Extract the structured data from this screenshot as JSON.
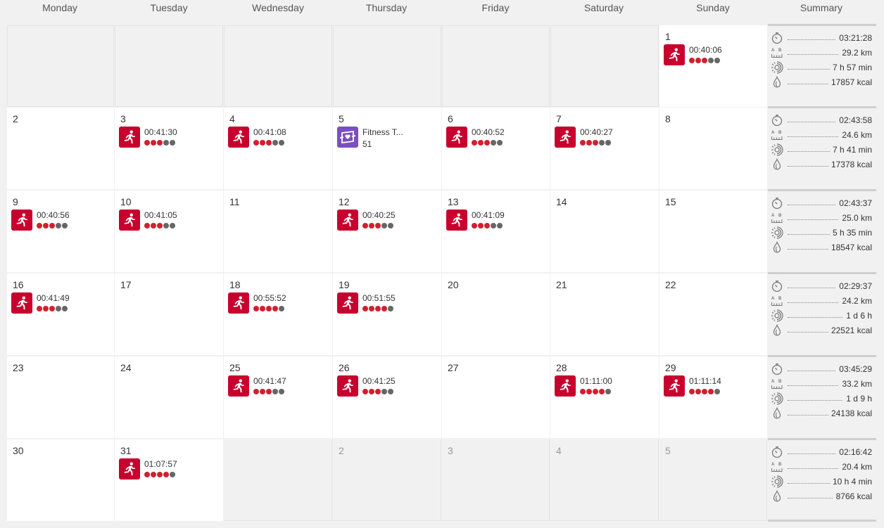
{
  "header": {
    "days": [
      "Monday",
      "Tuesday",
      "Wednesday",
      "Thursday",
      "Friday",
      "Saturday",
      "Sunday"
    ],
    "summary_label": "Summary"
  },
  "colors": {
    "running": "#c8002d",
    "fitness_test": "#7a4fbf",
    "intensity_on": "#d0202e",
    "intensity_off": "#666666"
  },
  "weeks": [
    {
      "days": [
        {
          "day": "",
          "state": "pre"
        },
        {
          "day": "",
          "state": "pre"
        },
        {
          "day": "",
          "state": "pre"
        },
        {
          "day": "",
          "state": "pre"
        },
        {
          "day": "",
          "state": "pre"
        },
        {
          "day": "",
          "state": "pre"
        },
        {
          "day": "1",
          "state": "in",
          "activity": {
            "type": "running",
            "icon": "running-icon",
            "value": "00:40:06",
            "intensity": 3
          }
        }
      ],
      "summary": {
        "duration": "03:21:28",
        "distance": "29.2 km",
        "recovery": "7 h 57 min",
        "calories": "17857 kcal"
      }
    },
    {
      "days": [
        {
          "day": "2",
          "state": "in"
        },
        {
          "day": "3",
          "state": "in",
          "activity": {
            "type": "running",
            "icon": "running-icon",
            "value": "00:41:30",
            "intensity": 3
          }
        },
        {
          "day": "4",
          "state": "in",
          "activity": {
            "type": "running",
            "icon": "running-icon",
            "value": "00:41:08",
            "intensity": 3
          }
        },
        {
          "day": "5",
          "state": "in",
          "activity": {
            "type": "fitness",
            "icon": "fitness-test-icon",
            "value": "Fitness T...",
            "sub": "51"
          }
        },
        {
          "day": "6",
          "state": "in",
          "activity": {
            "type": "running",
            "icon": "running-icon",
            "value": "00:40:52",
            "intensity": 3
          }
        },
        {
          "day": "7",
          "state": "in",
          "activity": {
            "type": "running",
            "icon": "running-icon",
            "value": "00:40:27",
            "intensity": 3
          }
        },
        {
          "day": "8",
          "state": "in"
        }
      ],
      "summary": {
        "duration": "02:43:58",
        "distance": "24.6 km",
        "recovery": "7 h 41 min",
        "calories": "17378 kcal"
      }
    },
    {
      "days": [
        {
          "day": "9",
          "state": "in",
          "activity": {
            "type": "running",
            "icon": "running-icon",
            "value": "00:40:56",
            "intensity": 3
          }
        },
        {
          "day": "10",
          "state": "in",
          "activity": {
            "type": "running",
            "icon": "running-icon",
            "value": "00:41:05",
            "intensity": 3
          }
        },
        {
          "day": "11",
          "state": "in"
        },
        {
          "day": "12",
          "state": "in",
          "activity": {
            "type": "running",
            "icon": "running-icon",
            "value": "00:40:25",
            "intensity": 3
          }
        },
        {
          "day": "13",
          "state": "in",
          "activity": {
            "type": "running",
            "icon": "running-icon",
            "value": "00:41:09",
            "intensity": 3
          }
        },
        {
          "day": "14",
          "state": "in"
        },
        {
          "day": "15",
          "state": "in"
        }
      ],
      "summary": {
        "duration": "02:43:37",
        "distance": "25.0 km",
        "recovery": "5 h 35 min",
        "calories": "18547 kcal"
      }
    },
    {
      "days": [
        {
          "day": "16",
          "state": "in",
          "activity": {
            "type": "running",
            "icon": "running-icon",
            "value": "00:41:49",
            "intensity": 3
          }
        },
        {
          "day": "17",
          "state": "in"
        },
        {
          "day": "18",
          "state": "in",
          "activity": {
            "type": "running",
            "icon": "running-icon",
            "value": "00:55:52",
            "intensity": 4
          }
        },
        {
          "day": "19",
          "state": "in",
          "activity": {
            "type": "running",
            "icon": "running-icon",
            "value": "00:51:55",
            "intensity": 4
          }
        },
        {
          "day": "20",
          "state": "in"
        },
        {
          "day": "21",
          "state": "in"
        },
        {
          "day": "22",
          "state": "in"
        }
      ],
      "summary": {
        "duration": "02:29:37",
        "distance": "24.2 km",
        "recovery": "1 d 6 h",
        "calories": "22521 kcal"
      }
    },
    {
      "days": [
        {
          "day": "23",
          "state": "in"
        },
        {
          "day": "24",
          "state": "in"
        },
        {
          "day": "25",
          "state": "in",
          "activity": {
            "type": "running",
            "icon": "running-icon",
            "value": "00:41:47",
            "intensity": 3
          }
        },
        {
          "day": "26",
          "state": "in",
          "activity": {
            "type": "running",
            "icon": "running-icon",
            "value": "00:41:25",
            "intensity": 3
          }
        },
        {
          "day": "27",
          "state": "in"
        },
        {
          "day": "28",
          "state": "in",
          "activity": {
            "type": "running",
            "icon": "running-icon",
            "value": "01:11:00",
            "intensity": 4
          }
        },
        {
          "day": "29",
          "state": "in",
          "activity": {
            "type": "running",
            "icon": "running-icon",
            "value": "01:11:14",
            "intensity": 4
          }
        }
      ],
      "summary": {
        "duration": "03:45:29",
        "distance": "33.2 km",
        "recovery": "1 d 9 h",
        "calories": "24138 kcal"
      }
    },
    {
      "days": [
        {
          "day": "30",
          "state": "in"
        },
        {
          "day": "31",
          "state": "in",
          "activity": {
            "type": "running",
            "icon": "running-icon",
            "value": "01:07:57",
            "intensity": 4
          }
        },
        {
          "day": "",
          "state": "out"
        },
        {
          "day": "2",
          "state": "out"
        },
        {
          "day": "3",
          "state": "out"
        },
        {
          "day": "4",
          "state": "out"
        },
        {
          "day": "5",
          "state": "out"
        }
      ],
      "summary": {
        "duration": "02:16:42",
        "distance": "20.4 km",
        "recovery": "10 h 4 min",
        "calories": "8766 kcal"
      }
    }
  ],
  "summary_icons": {
    "duration": "stopwatch-icon",
    "distance": "distance-ruler-icon",
    "recovery": "recovery-icon",
    "calories": "calories-flame-icon"
  },
  "intensity_max": 5
}
